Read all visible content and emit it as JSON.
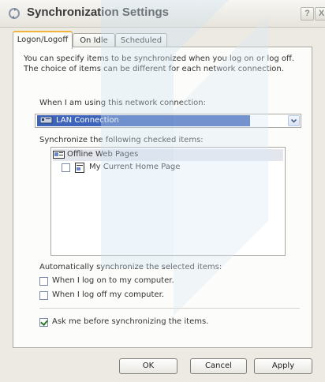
{
  "window": {
    "title": "Synchronization Settings",
    "help_label": "?",
    "close_label": "X"
  },
  "tabs": [
    {
      "label": "Logon/Logoff",
      "active": true
    },
    {
      "label": "On Idle",
      "active": false
    },
    {
      "label": "Scheduled",
      "active": false
    }
  ],
  "description": {
    "line1": "You can specify items to be synchronized when you log on or log off.",
    "line2": "The choice of items can be different for each network connection."
  },
  "connection": {
    "label": "When I am using this network connection:",
    "selected": "LAN Connection"
  },
  "items": {
    "label": "Synchronize the following checked items:",
    "parent": "Offline Web Pages",
    "children": [
      {
        "label": "My Current Home Page",
        "checked": false
      }
    ]
  },
  "auto_sync": {
    "label": "Automatically synchronize the selected items:",
    "options": [
      {
        "label": "When I log on to my computer.",
        "checked": false
      },
      {
        "label": "When I log off my computer.",
        "checked": false
      }
    ]
  },
  "ask": {
    "label": "Ask me before synchronizing the items.",
    "checked": true
  },
  "buttons": {
    "ok": "OK",
    "cancel": "Cancel",
    "apply": "Apply"
  },
  "icons": {
    "title": "sync-icon",
    "connection": "network-icon",
    "offline_pages": "offline-web-pages-icon",
    "home_page": "web-page-icon"
  },
  "colors": {
    "selection": "#3d64ba",
    "active_tab_accent": "#f0b43c",
    "dialog_background": "#eceae3"
  }
}
